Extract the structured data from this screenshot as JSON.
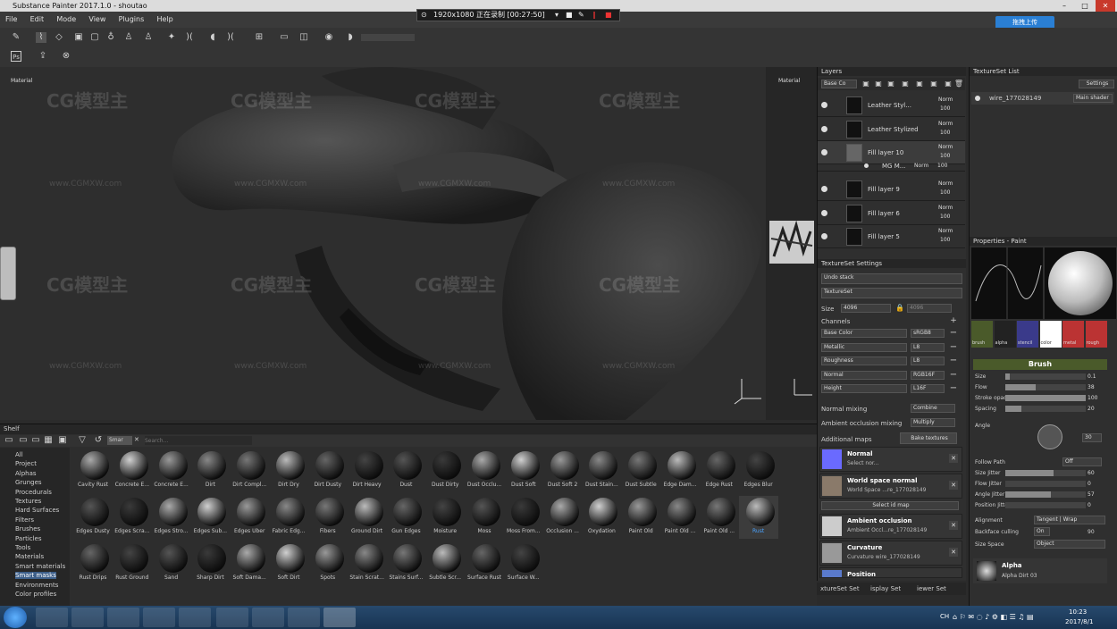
{
  "window": {
    "title": "Substance Painter 2017.1.0 - shoutao"
  },
  "menu": [
    "File",
    "Edit",
    "Mode",
    "View",
    "Plugins",
    "Help"
  ],
  "recorder": {
    "text": "1920x1080 正在录制 [00:27:50]"
  },
  "upload_label": "拖拽上传",
  "viewport": {
    "label_left": "Material",
    "label_right": "Material"
  },
  "watermark": {
    "logo": "CG模型主",
    "url": "www.CGMXW.com"
  },
  "shelf": {
    "title": "Shelf",
    "filter_tag": "Smar",
    "search_placeholder": "Search...",
    "categories": [
      "All",
      "Project",
      "Alphas",
      "Grunges",
      "Procedurals",
      "Textures",
      "Hard Surfaces",
      "Filters",
      "Brushes",
      "Particles",
      "Tools",
      "Materials",
      "Smart materials",
      "Smart masks",
      "Environments",
      "Color profiles"
    ],
    "selected_category": "Smart masks",
    "items": [
      "Cavity Rust",
      "Concrete E...",
      "Concrete E...",
      "Dirt",
      "Dirt Compl...",
      "Dirt Dry",
      "Dirt Dusty",
      "Dirt Heavy",
      "Dust",
      "Dust Dirty",
      "Dust Occlu...",
      "Dust Soft",
      "Dust Soft 2",
      "Dust Stain...",
      "Dust Subtle",
      "Edge Dam...",
      "Edge Rust",
      "Edges Blur",
      "Edges Dusty",
      "Edges Scra...",
      "Edges Stro...",
      "Edges Sub...",
      "Edges Uber",
      "Fabric Edg...",
      "Fibers",
      "Ground Dirt",
      "Gun Edges",
      "Moisture",
      "Moss",
      "Moss From...",
      "Occlusion ...",
      "Oxydation",
      "Paint Old",
      "Paint Old ...",
      "Paint Old ...",
      "Rust",
      "Rust Drips",
      "Rust Ground",
      "Sand",
      "Sharp Dirt",
      "Soft Dama...",
      "Soft Dirt",
      "Spots",
      "Stain Scrat...",
      "Stains Surf...",
      "Subtle Scr...",
      "Surface Rust",
      "Surface W..."
    ],
    "selected_item": "Rust"
  },
  "layers": {
    "title": "Layers",
    "channel": "Base Co",
    "rows": [
      {
        "name": "Leather Styl...",
        "blend": "Norm",
        "opacity": "100"
      },
      {
        "name": "Leather Stylized",
        "blend": "Norm",
        "opacity": "100"
      },
      {
        "name": "Fill layer 10",
        "blend": "Norm",
        "opacity": "100"
      },
      {
        "name": "MG M...",
        "blend": "Norm",
        "opacity": "100"
      },
      {
        "name": "Fill layer 9",
        "blend": "Norm",
        "opacity": "100"
      },
      {
        "name": "Fill layer 6",
        "blend": "Norm",
        "opacity": "100"
      },
      {
        "name": "Fill layer 5",
        "blend": "Norm",
        "opacity": "100"
      }
    ]
  },
  "texture_set_settings": {
    "title": "TextureSet Settings",
    "undo_stack": "Undo stack",
    "textureset": "TextureSet",
    "size_label": "Size",
    "size_value": "4096",
    "size_value2": "4096",
    "channels_label": "Channels",
    "channels": [
      {
        "name": "Base Color",
        "format": "sRGB8"
      },
      {
        "name": "Metallic",
        "format": "L8"
      },
      {
        "name": "Roughness",
        "format": "L8"
      },
      {
        "name": "Normal",
        "format": "RGB16F"
      },
      {
        "name": "Height",
        "format": "L16F"
      }
    ],
    "normal_mixing_label": "Normal mixing",
    "normal_mixing_value": "Combine",
    "ao_mixing_label": "Ambient occlusion mixing",
    "ao_mixing_value": "Multiply",
    "additional_maps_label": "Additional maps",
    "bake_button": "Bake textures",
    "maps": [
      {
        "title": "Normal",
        "sub": "Select nor..."
      },
      {
        "title": "World space normal",
        "sub": "World Space ...re_177028149"
      },
      {
        "title": "Ambient occlusion",
        "sub": "Ambient Occl...re_177028149"
      },
      {
        "title": "Curvature",
        "sub": "Curvature wire_177028149"
      },
      {
        "title": "Position",
        "sub": ""
      }
    ],
    "select_id_map": "Select id map",
    "bottom_tabs": [
      "xtureSet Set",
      "isplay Set",
      "iewer Set"
    ]
  },
  "textureset_list": {
    "title": "TextureSet List",
    "settings": "Settings",
    "item": "wire_177028149",
    "shader": "Main shader"
  },
  "properties": {
    "title": "Properties - Paint",
    "tiles": [
      "brush",
      "alpha",
      "stencil",
      "color",
      "metal",
      "rough"
    ],
    "section": "Brush",
    "params": [
      {
        "name": "Size",
        "value": "0.1",
        "fill": 0.05
      },
      {
        "name": "Flow",
        "value": "38",
        "fill": 0.38
      },
      {
        "name": "Stroke opacity",
        "value": "100",
        "fill": 1.0
      },
      {
        "name": "Spacing",
        "value": "20",
        "fill": 0.2
      }
    ],
    "angle_label": "Angle",
    "angle_value": "30",
    "follow_path_label": "Follow Path",
    "follow_path_value": "Off",
    "jitters": [
      {
        "name": "Size Jitter",
        "value": "60",
        "fill": 0.6
      },
      {
        "name": "Flow Jitter",
        "value": "0",
        "fill": 0.0
      },
      {
        "name": "Angle Jitter",
        "value": "57",
        "fill": 0.57
      },
      {
        "name": "Position Jitter",
        "value": "0",
        "fill": 0.0
      }
    ],
    "alignment_label": "Alignment",
    "alignment_value": "Tangent | Wrap",
    "backface_label": "Backface culling",
    "backface_value": "On",
    "backface_num": "90",
    "sizespace_label": "Size Space",
    "sizespace_value": "Object",
    "alpha_title": "Alpha",
    "alpha_sub": "Alpha Dirt 03"
  },
  "taskbar": {
    "time": "10:23",
    "date": "2017/8/1",
    "lang": "CH"
  }
}
